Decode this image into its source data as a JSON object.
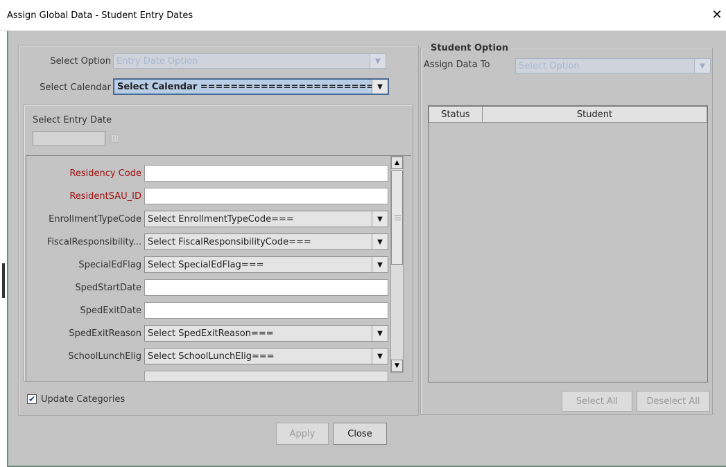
{
  "window": {
    "title": "Assign Global Data - Student Entry Dates",
    "close_glyph": "✕"
  },
  "left": {
    "select_option_label": "Select Option",
    "select_option_value": "Entry Date Option",
    "select_calendar_label": "Select Calendar",
    "select_calendar_value": "Select Calendar =======================",
    "entry_date_label": "Select Entry Date",
    "entry_date_value": "",
    "fields": [
      {
        "label": "Residency Code",
        "type": "text",
        "value": "",
        "required": true
      },
      {
        "label": "ResidentSAU_ID",
        "type": "text",
        "value": "",
        "required": true
      },
      {
        "label": "EnrollmentTypeCode",
        "type": "combo",
        "value": "Select EnrollmentTypeCode===",
        "required": false
      },
      {
        "label": "FiscalResponsibility...",
        "type": "combo",
        "value": "Select FiscalResponsibilityCode===",
        "required": false
      },
      {
        "label": "SpecialEdFlag",
        "type": "combo",
        "value": "Select SpecialEdFlag===",
        "required": false
      },
      {
        "label": "SpedStartDate",
        "type": "text",
        "value": "",
        "required": false
      },
      {
        "label": "SpedExitDate",
        "type": "text",
        "value": "",
        "required": false
      },
      {
        "label": "SpedExitReason",
        "type": "combo",
        "value": "Select SpedExitReason===",
        "required": false
      },
      {
        "label": "SchoolLunchElig",
        "type": "combo",
        "value": "Select SchoolLunchElig===",
        "required": false
      }
    ],
    "update_categories_label": "Update Categories",
    "update_categories_checked": true
  },
  "right": {
    "group_title": "Student Option",
    "assign_label": "Assign Data To",
    "assign_value": "Select Option",
    "columns": [
      "Status",
      "Student"
    ],
    "select_all_label": "Select All",
    "deselect_all_label": "Deselect All"
  },
  "footer": {
    "apply_label": "Apply",
    "close_label": "Close"
  },
  "colors": {
    "dialog_bg": "#c4c4c4",
    "required_label": "#a01010",
    "highlight_combo": "#b8cde6",
    "disabled_text": "#aab8d0"
  },
  "icons": {
    "calendar": "calendar-icon",
    "close": "close-icon",
    "dropdown": "chevron-down-icon",
    "check": "check-icon"
  }
}
